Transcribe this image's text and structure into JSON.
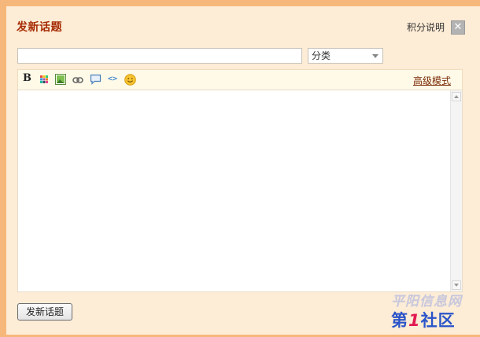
{
  "dialog": {
    "title": "发新话题",
    "help_label": "积分说明",
    "close_glyph": "✕"
  },
  "form": {
    "subject_value": "",
    "category_selected": "分类"
  },
  "toolbar": {
    "bold_glyph": "B",
    "code_glyph": "<>",
    "advanced_label": "高级模式",
    "icons": [
      "bold-icon",
      "color-icon",
      "image-icon",
      "link-icon",
      "quote-icon",
      "code-icon",
      "smiley-icon"
    ]
  },
  "editor": {
    "content": ""
  },
  "submit": {
    "label": "发新话题"
  },
  "watermark": {
    "line1": "平阳信息网",
    "line2_a": "第",
    "line2_num": "1",
    "line2_b": "社区"
  },
  "colors": {
    "frame": "#f6b87a",
    "dialog_bg": "#fdecd6",
    "title": "#a62c05",
    "watermark_blue": "#2a54c9",
    "watermark_red": "#e21a52"
  }
}
